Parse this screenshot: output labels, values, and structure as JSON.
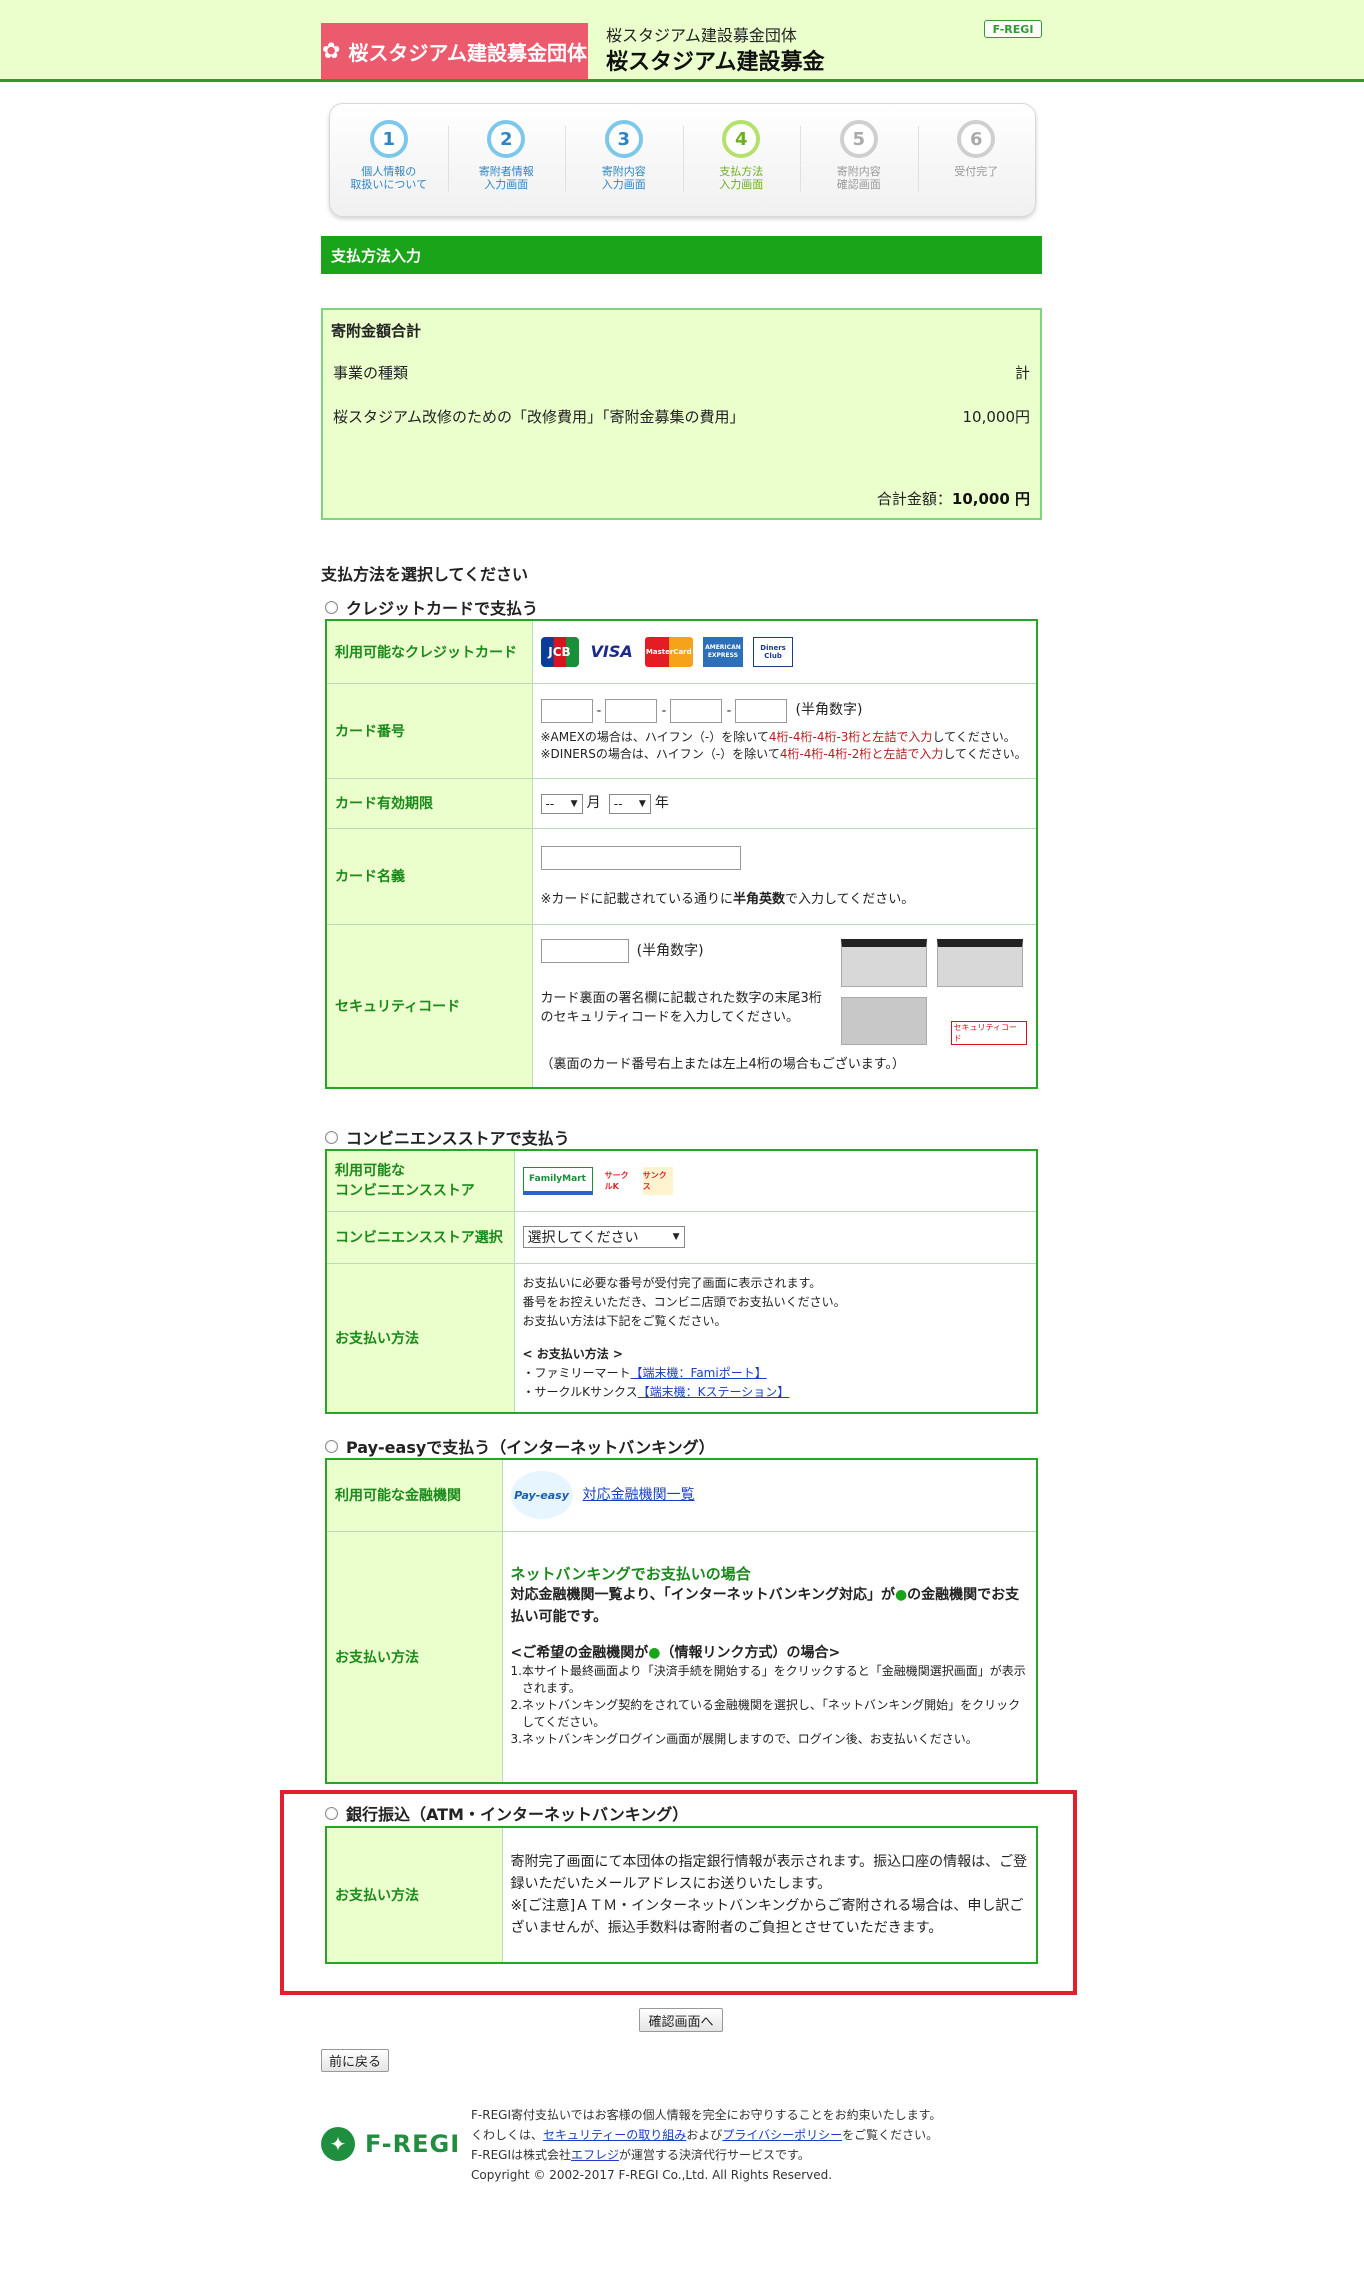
{
  "header": {
    "logo_text": "桜スタジアム建設募金団体",
    "org_name": "桜スタジアム建設募金団体",
    "title": "桜スタジアム建設募金",
    "badge": "F-REGI"
  },
  "steps": [
    {
      "num": "1",
      "label": "個人情報の\n取扱いについて",
      "state": "done"
    },
    {
      "num": "2",
      "label": "寄附者情報\n入力画面",
      "state": "done"
    },
    {
      "num": "3",
      "label": "寄附内容\n入力画面",
      "state": "done"
    },
    {
      "num": "4",
      "label": "支払方法\n入力画面",
      "state": "current"
    },
    {
      "num": "5",
      "label": "寄附内容\n確認画面",
      "state": "future"
    },
    {
      "num": "6",
      "label": "受付完了",
      "state": "future"
    }
  ],
  "section_title": "支払方法入力",
  "summary": {
    "heading": "寄附金額合計",
    "col_type": "事業の種類",
    "col_total": "計",
    "item_name": "桜スタジアム改修のための「改修費用」「寄附金募集の費用」",
    "item_amount": "10,000円",
    "total_label": "合計金額：",
    "total_value": "10,000 円"
  },
  "payment_select_title": "支払方法を選択してください",
  "credit": {
    "title": "クレジットカードで支払う",
    "row_cards": "利用可能なクレジットカード",
    "cards": [
      "JCB",
      "VISA",
      "MasterCard",
      "AMERICAN EXPRESS",
      "Diners Club"
    ],
    "row_number": "カード番号",
    "number_hint": "(半角数字)",
    "amex_note_a": "※AMEXの場合は、ハイフン（-）を除いて",
    "amex_note_b": "4桁-4桁-4桁-3桁と左詰で入力",
    "amex_note_c": "してください。",
    "diners_note_a": "※DINERSの場合は、ハイフン（-）を除いて",
    "diners_note_b": "4桁-4桁-4桁-2桁と左詰で入力",
    "diners_note_c": "してください。",
    "row_expiry": "カード有効期限",
    "expiry_month_sel": "--",
    "expiry_month_label": "月",
    "expiry_year_sel": "--",
    "expiry_year_label": "年",
    "row_name": "カード名義",
    "name_note_a": "※カードに記載されている通りに",
    "name_note_b": "半角英数",
    "name_note_c": "で入力してください。",
    "row_security": "セキュリティコード",
    "security_hint": "(半角数字)",
    "security_desc": "カード裏面の署名欄に記載された数字の末尾3桁のセキュリティコードを入力してください。",
    "security_desc2": "（裏面のカード番号右上または左上4桁の場合もございます。）",
    "security_img_label": "セキュリティコード"
  },
  "cvs": {
    "title": "コンビニエンスストアで支払う",
    "row_available": "利用可能な\nコンビニエンスストア",
    "logos": [
      "FamilyMart",
      "サークルK",
      "サンクス"
    ],
    "row_select": "コンビニエンスストア選択",
    "select_value": "選択してください",
    "row_method": "お支払い方法",
    "method_line1": "お支払いに必要な番号が受付完了画面に表示されます。",
    "method_line2": "番号をお控えいただき、コンビニ店頭でお支払いください。",
    "method_line3": "お支払い方法は下記をご覧ください。",
    "method_heading": "< お支払い方法 >",
    "famima_label": "・ファミリーマート",
    "famima_link": "【端末機：Famiポート】",
    "circlek_label": "・サークルKサンクス",
    "circlek_link": "【端末機：Kステーション】"
  },
  "payeasy": {
    "title": "Pay-easyで支払う（インターネットバンキング）",
    "row_banks": "利用可能な金融機関",
    "logo_text": "Pay-easy",
    "bank_link": "対応金融機関一覧",
    "row_method": "お支払い方法",
    "netbank_heading": "ネットバンキングでお支払いの場合",
    "netbank_desc_a": "対応金融機関一覧より、「インターネットバンキング対応」が",
    "netbank_desc_b": "の金融機関でお支払い可能です。",
    "pref_heading_a": "<ご希望の金融機関が",
    "pref_heading_b": "（情報リンク方式）の場合>",
    "step1_num": "1.",
    "step1": "本サイト最終画面より「決済手続を開始する」をクリックすると「金融機関選択画面」が表示されます。",
    "step2_num": "2.",
    "step2": "ネットバンキング契約をされている金融機関を選択し、「ネットバンキング開始」をクリックしてください。",
    "step3_num": "3.",
    "step3": "ネットバンキングログイン画面が展開しますので、ログイン後、お支払いください。"
  },
  "bank": {
    "title": "銀行振込（ATM・インターネットバンキング）",
    "row_method": "お支払い方法",
    "desc1": "寄附完了画面にて本団体の指定銀行情報が表示されます。振込口座の情報は、ご登録いただいたメールアドレスにお送りいたします。",
    "desc2": "※[ご注意]ＡＴＭ・インターネットバンキングからご寄附される場合は、申し訳ございませんが、振込手数料は寄附者のご負担とさせていただきます。"
  },
  "buttons": {
    "confirm": "確認画面へ",
    "back": "前に戻る"
  },
  "footer": {
    "logo_name": "F-REGI",
    "line1": "F-REGI寄付支払いではお客様の個人情報を完全にお守りすることをお約束いたします。",
    "line2_a": "くわしくは、",
    "line2_link1": "セキュリティーの取り組み",
    "line2_b": "および",
    "line2_link2": "プライバシーポリシー",
    "line2_c": "をご覧ください。",
    "line3_a": "F-REGIは株式会社",
    "line3_link": "エフレジ",
    "line3_b": "が運営する決済代行サービスです。",
    "copyright": "Copyright © 2002-2017 F-REGI Co.,Ltd. All Rights Reserved."
  },
  "colors": {
    "accent_green": "#1aa41a",
    "header_pink": "#ec5a6e",
    "highlight_red": "#e0212d",
    "pale_green": "#eaffcc"
  }
}
